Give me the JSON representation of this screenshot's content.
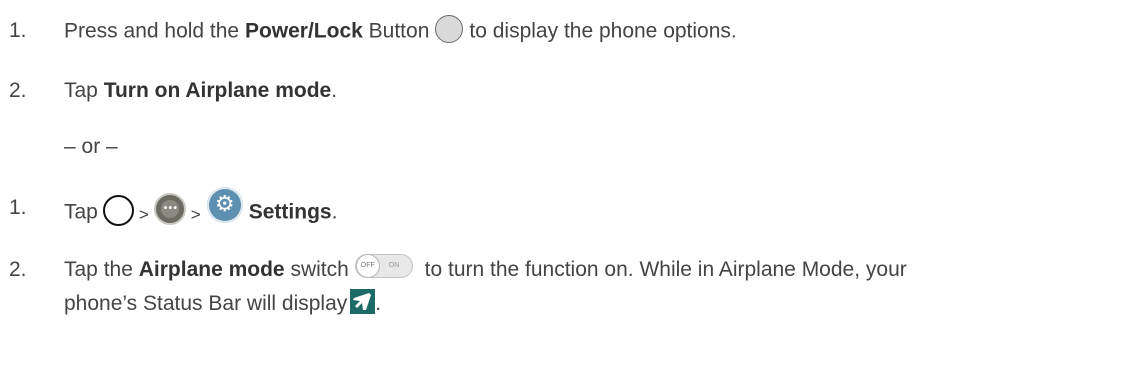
{
  "steps_a": [
    {
      "num": "1.",
      "pre": "Press and hold the ",
      "bold": "Power/Lock",
      "mid": " Button",
      "post": "to display the phone options."
    },
    {
      "num": "2.",
      "pre": "Tap ",
      "bold": "Turn on Airplane mode",
      "post": "."
    }
  ],
  "separator": "– or –",
  "steps_b": [
    {
      "num": "1.",
      "pre": "Tap",
      "gt1": ">",
      "gt2": ">",
      "bold": "Settings",
      "post": "."
    },
    {
      "num": "2.",
      "pre": "Tap the ",
      "bold": "Airplane mode",
      "mid": " switch",
      "post": " to turn the function on. While in Airplane Mode, your",
      "line2": "phone’s Status Bar will display",
      "end": "."
    }
  ],
  "icons": {
    "power_button": "power-lock-button-icon",
    "home": "home-button-icon",
    "apps": "apps-icon",
    "settings": "settings-gear-icon",
    "toggle": "airplane-mode-switch-icon",
    "toggle_off": "OFF",
    "toggle_on": "ON",
    "airplane": "airplane-mode-status-icon"
  }
}
